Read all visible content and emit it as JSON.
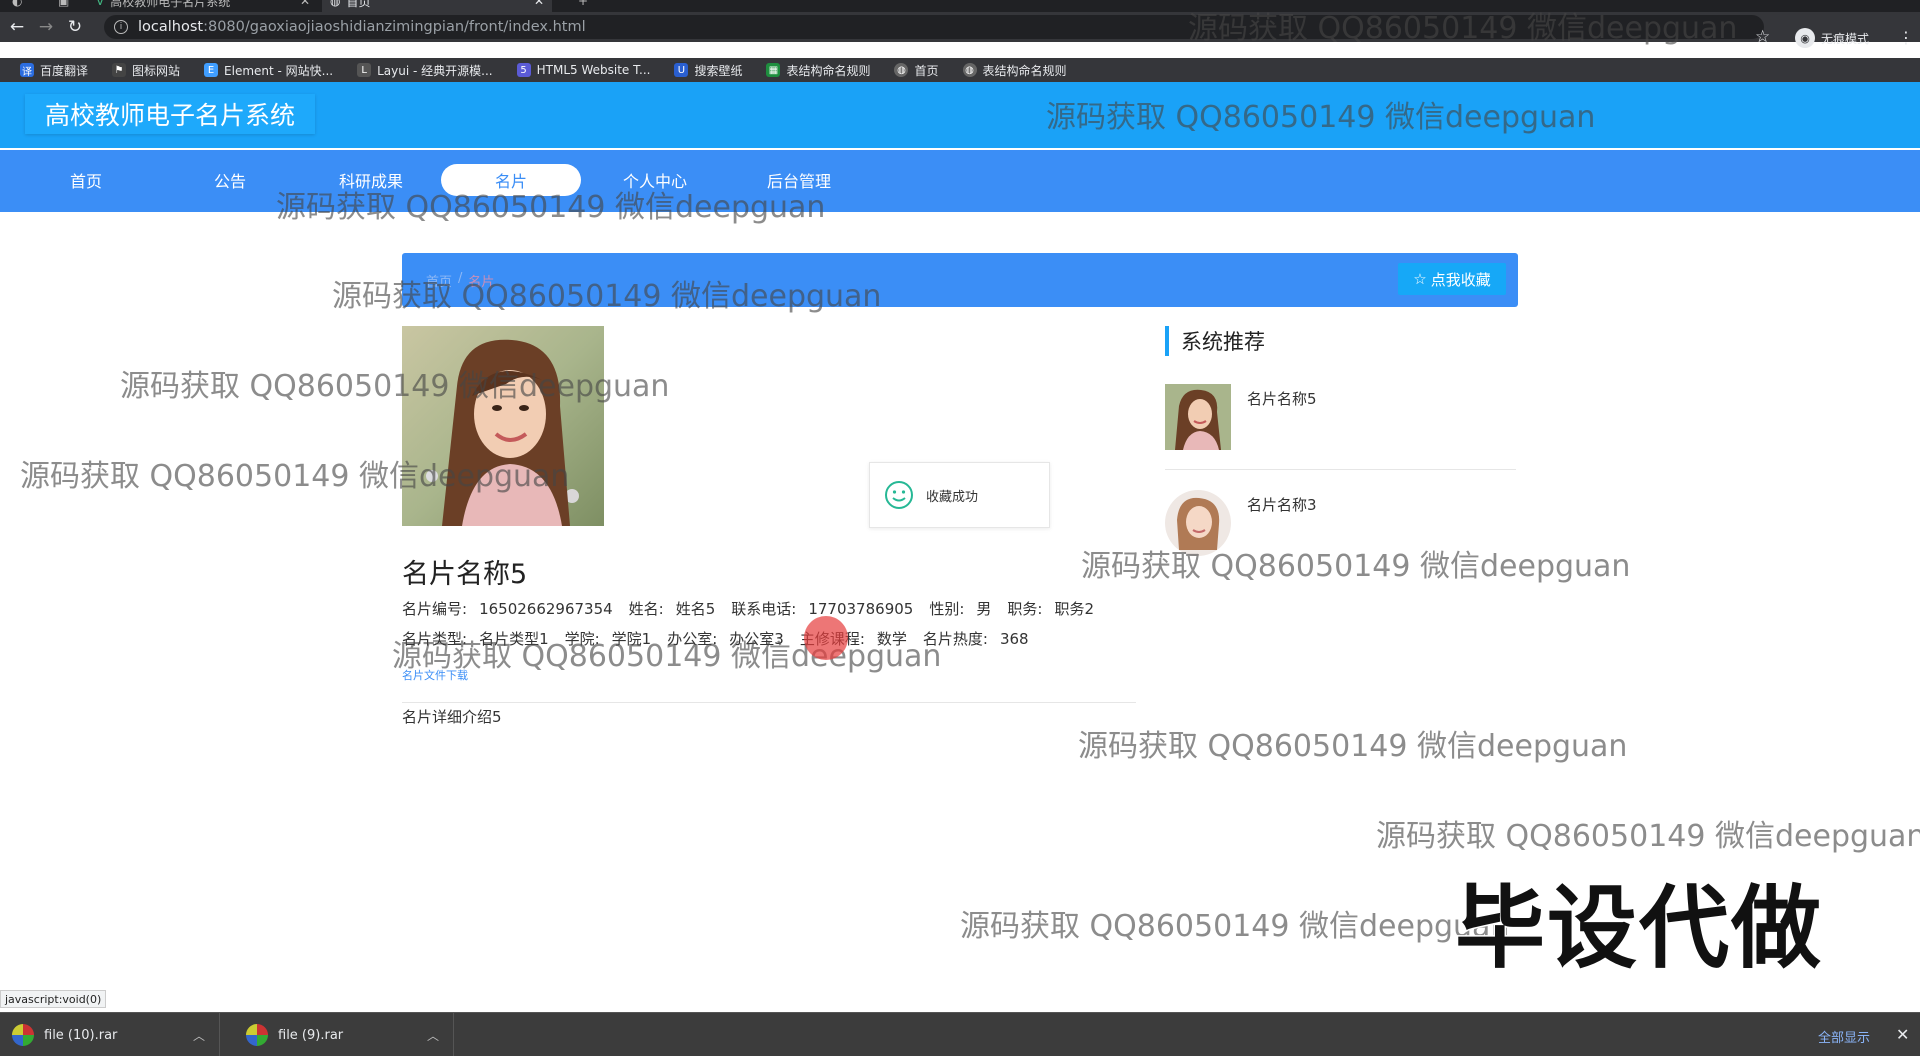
{
  "browser": {
    "tabs": [
      {
        "label": "高校教师电子名片系统",
        "active": false
      },
      {
        "label": "首页",
        "active": true
      }
    ],
    "new_tab": "+",
    "url_host": "localhost",
    "url_path": ":8080/gaoxiaojiaoshidianzimingpian/front/index.html",
    "profile_label": "无痕模式",
    "bookmarks": [
      {
        "label": "百度翻译",
        "color": "#2b6de0"
      },
      {
        "label": "图标网站",
        "color": "#444444"
      },
      {
        "label": "Element - 网站快...",
        "color": "#409eff"
      },
      {
        "label": "Layui - 经典开源模...",
        "color": "#555555"
      },
      {
        "label": "HTML5 Website T...",
        "color": "#5b5bd6"
      },
      {
        "label": "搜索壁纸",
        "color": "#2a5fd0"
      },
      {
        "label": "表结构命名规则",
        "color": "#1e8e3e"
      },
      {
        "label": "首页",
        "color": "#666666"
      },
      {
        "label": "表结构命名规则",
        "color": "#666666"
      }
    ]
  },
  "site": {
    "title": "高校教师电子名片系统",
    "nav": [
      {
        "label": "首页",
        "active": false
      },
      {
        "label": "公告",
        "active": false
      },
      {
        "label": "科研成果",
        "active": false
      },
      {
        "label": "名片",
        "active": true
      },
      {
        "label": "个人中心",
        "active": false
      },
      {
        "label": "后台管理",
        "active": false
      }
    ],
    "breadcrumb": {
      "home": "首页",
      "sep": "/",
      "current": "名片"
    },
    "favorite_button": "点我收藏"
  },
  "card": {
    "title": "名片名称5",
    "row1": [
      {
        "label": "名片编号:",
        "value": "16502662967354"
      },
      {
        "label": "姓名:",
        "value": "姓名5"
      },
      {
        "label": "联系电话:",
        "value": "17703786905"
      },
      {
        "label": "性别:",
        "value": "男"
      },
      {
        "label": "职务:",
        "value": "职务2"
      }
    ],
    "row2": [
      {
        "label": "名片类型:",
        "value": "名片类型1"
      },
      {
        "label": "学院:",
        "value": "学院1"
      },
      {
        "label": "办公室:",
        "value": "办公室3"
      },
      {
        "label": "主修课程:",
        "value": "数学"
      },
      {
        "label": "名片热度:",
        "value": "368"
      }
    ],
    "download_link": "名片文件下载",
    "detail": "名片详细介绍5"
  },
  "toast": {
    "message": "收藏成功"
  },
  "sidebar": {
    "title": "系统推荐",
    "items": [
      {
        "name": "名片名称5"
      },
      {
        "name": "名片名称3"
      }
    ]
  },
  "overlays": {
    "watermark": "源码获取 QQ86050149 微信deepguan",
    "big_watermark": "毕设代做",
    "status_url": "javascript:void(0)"
  },
  "downloads": {
    "files": [
      {
        "name": "file (10).rar"
      },
      {
        "name": "file (9).rar"
      }
    ],
    "show_all": "全部显示"
  },
  "colors": {
    "header": "#1aa2f7",
    "nav": "#3b8ef6",
    "accent": "#16a8f7"
  }
}
